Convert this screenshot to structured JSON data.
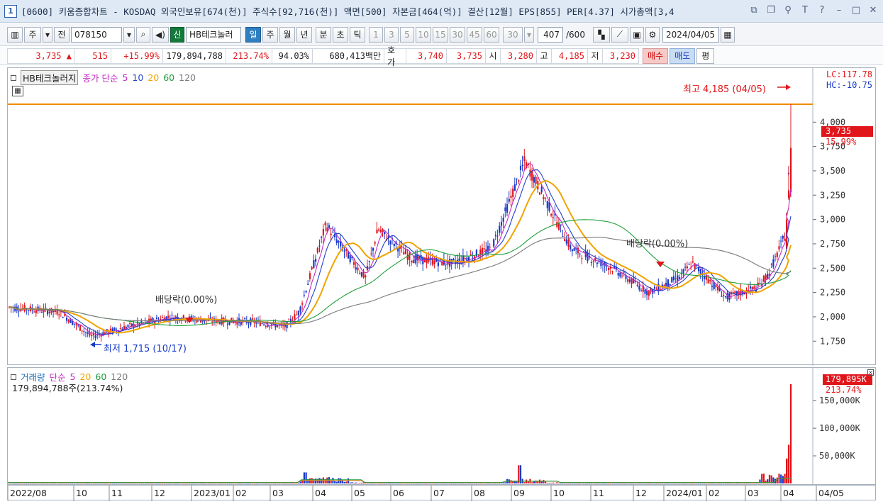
{
  "window": {
    "number": "1",
    "title": "[0600] 키움종합차트 - KOSDAQ 외국인보유[674(천)] 주식수[92,716(천)] 액면[500] 자본금[464(억)] 결산[12월] EPS[855] PER[4.37] 시가총액[3,4"
  },
  "toolbar": {
    "market_type": "주",
    "prev_label": "전",
    "code": "078150",
    "new_badge": "신",
    "stock_name": "HB테크놀러",
    "periods": [
      "일",
      "주",
      "월",
      "년",
      "분",
      "초",
      "틱"
    ],
    "active_period": "일",
    "intervals": [
      "1",
      "3",
      "5",
      "10",
      "15",
      "30",
      "45",
      "60"
    ],
    "interval_select": "30",
    "count": "407",
    "count_max": "/600",
    "date": "2024/04/05"
  },
  "quote": {
    "price": "3,735",
    "change_arrow": "▲",
    "change": "515",
    "change_pct": "+15.99%",
    "volume": "179,894,788",
    "volume_ratio": "213.74%",
    "turnover": "94.03%",
    "amount": "680,413백만",
    "ask_label": "호가",
    "ask": "3,740",
    "bid": "3,735",
    "open_label": "시",
    "open": "3,280",
    "high_label": "고",
    "high": "4,185",
    "low_label": "저",
    "low": "3,230",
    "buy_label": "매수",
    "sell_label": "매도",
    "eval_label": "평"
  },
  "price_legend": {
    "name": "HB테크놀러지",
    "ma_label": "종가 단순",
    "ma_periods": [
      "5",
      "10",
      "20",
      "60",
      "120"
    ]
  },
  "volume_legend": {
    "name": "거래량",
    "ma_label": "단순",
    "ma_periods": [
      "5",
      "20",
      "60",
      "120"
    ],
    "current": "179,894,788주(213.74%)"
  },
  "annotations": {
    "lc": "LC:117.78",
    "hc": "HC:-10.75",
    "high_marker": "최고 4,185 (04/05)",
    "low_marker": "최저 1,715 (10/17)",
    "dividend_1": "배당락(0.00%)",
    "dividend_2": "배당락(0.00%)",
    "last_price_tag": "3,735",
    "last_pct_tag": "15.99%",
    "last_vol_tag": "179,895K",
    "last_vol_pct": "213.74%"
  },
  "colors": {
    "up": "#e0161b",
    "down": "#1739c8",
    "ma5": "#c42bc4",
    "ma10": "#2440c8",
    "ma20": "#f0a300",
    "ma60": "#1e9e3a",
    "ma120": "#7a7a7a",
    "high_line": "#f08a00"
  },
  "chart_data": {
    "type": "line",
    "price_axis": {
      "ticks": [
        "4,000",
        "3,750",
        "3,500",
        "3,250",
        "3,000",
        "2,750",
        "2,500",
        "2,250",
        "2,000",
        "1,750"
      ],
      "ylim": [
        1570,
        4410
      ]
    },
    "volume_axis": {
      "ticks": [
        "150,000K",
        "100,000K",
        "50,000K"
      ],
      "ylim": [
        0,
        190000
      ]
    },
    "x_ticks": [
      "2022/08",
      "10",
      "11",
      "12",
      "2023/01",
      "02",
      "03",
      "04",
      "05",
      "06",
      "07",
      "08",
      "09",
      "10",
      "11",
      "12",
      "2024/01",
      "02",
      "03",
      "04",
      "04/05"
    ],
    "close_trend": {
      "x": [
        "2022/08",
        "2022/09",
        "2022/10",
        "2022/11",
        "2022/12",
        "2023/01",
        "2023/02",
        "2023/03",
        "2023/03",
        "2023/04",
        "2023/04",
        "2023/05",
        "2023/05",
        "2023/06",
        "2023/07",
        "2023/08",
        "2023/09",
        "2023/09",
        "2023/10",
        "2023/11",
        "2023/12",
        "2024/01",
        "2024/01",
        "2024/02",
        "2024/03",
        "2024/03",
        "2024/04",
        "2024/04"
      ],
      "values": [
        2100,
        2050,
        1800,
        1900,
        2000,
        1960,
        1950,
        1900,
        2050,
        2950,
        2750,
        2400,
        2900,
        2600,
        2550,
        2700,
        3600,
        3350,
        2700,
        2500,
        2250,
        2400,
        2550,
        2200,
        2300,
        2450,
        2850,
        3735
      ]
    },
    "volume_trend": {
      "x": [
        "2023/04",
        "2023/09",
        "2024/04"
      ],
      "values": [
        20000,
        33000,
        179895
      ]
    },
    "high": {
      "label": "최고",
      "value": 4185,
      "date": "04/05"
    },
    "low": {
      "label": "최저",
      "value": 1715,
      "date": "10/17"
    }
  }
}
